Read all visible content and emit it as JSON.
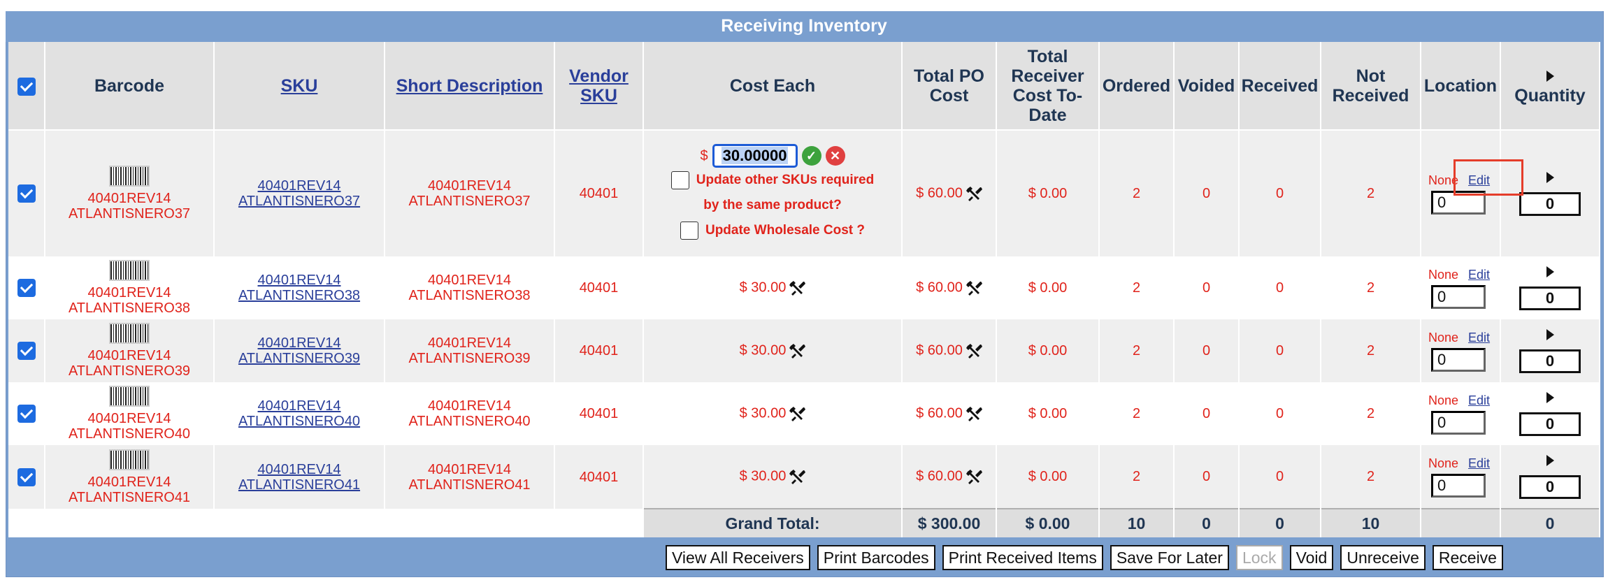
{
  "title": "Receiving Inventory",
  "headers": {
    "barcode": "Barcode",
    "sku": "SKU",
    "short_description": "Short Description",
    "vendor_sku": "Vendor SKU",
    "cost_each": "Cost Each",
    "total_po_cost": "Total PO Cost",
    "total_receiver_cost": "Total Receiver Cost To-Date",
    "ordered": "Ordered",
    "voided": "Voided",
    "received": "Received",
    "not_received": "Not Received",
    "location": "Location",
    "quantity": "Quantity"
  },
  "editing": {
    "currency": "$",
    "value": "30.00000",
    "update_other_skus": "Update other SKUs required",
    "update_other_skus_2": "by the same product?",
    "update_wholesale": "Update Wholesale Cost ?"
  },
  "rows": [
    {
      "barcode_l1": "40401REV14",
      "barcode_l2": "ATLANTISNERO37",
      "sku_l1": "40401REV14",
      "sku_l2": "ATLANTISNERO37",
      "desc_l1": "40401REV14",
      "desc_l2": "ATLANTISNERO37",
      "vendor_sku": "40401",
      "cost_each": "$ 30.00",
      "total_po": "$ 60.00",
      "receiver_cost": "$ 0.00",
      "ordered": "2",
      "voided": "0",
      "received": "0",
      "not_received": "2",
      "loc_none": "None",
      "loc_edit": "Edit",
      "loc_value": "0",
      "qty": "0"
    },
    {
      "barcode_l1": "40401REV14",
      "barcode_l2": "ATLANTISNERO38",
      "sku_l1": "40401REV14",
      "sku_l2": "ATLANTISNERO38",
      "desc_l1": "40401REV14",
      "desc_l2": "ATLANTISNERO38",
      "vendor_sku": "40401",
      "cost_each": "$ 30.00",
      "total_po": "$ 60.00",
      "receiver_cost": "$ 0.00",
      "ordered": "2",
      "voided": "0",
      "received": "0",
      "not_received": "2",
      "loc_none": "None",
      "loc_edit": "Edit",
      "loc_value": "0",
      "qty": "0"
    },
    {
      "barcode_l1": "40401REV14",
      "barcode_l2": "ATLANTISNERO39",
      "sku_l1": "40401REV14",
      "sku_l2": "ATLANTISNERO39",
      "desc_l1": "40401REV14",
      "desc_l2": "ATLANTISNERO39",
      "vendor_sku": "40401",
      "cost_each": "$ 30.00",
      "total_po": "$ 60.00",
      "receiver_cost": "$ 0.00",
      "ordered": "2",
      "voided": "0",
      "received": "0",
      "not_received": "2",
      "loc_none": "None",
      "loc_edit": "Edit",
      "loc_value": "0",
      "qty": "0"
    },
    {
      "barcode_l1": "40401REV14",
      "barcode_l2": "ATLANTISNERO40",
      "sku_l1": "40401REV14",
      "sku_l2": "ATLANTISNERO40",
      "desc_l1": "40401REV14",
      "desc_l2": "ATLANTISNERO40",
      "vendor_sku": "40401",
      "cost_each": "$ 30.00",
      "total_po": "$ 60.00",
      "receiver_cost": "$ 0.00",
      "ordered": "2",
      "voided": "0",
      "received": "0",
      "not_received": "2",
      "loc_none": "None",
      "loc_edit": "Edit",
      "loc_value": "0",
      "qty": "0"
    },
    {
      "barcode_l1": "40401REV14",
      "barcode_l2": "ATLANTISNERO41",
      "sku_l1": "40401REV14",
      "sku_l2": "ATLANTISNERO41",
      "desc_l1": "40401REV14",
      "desc_l2": "ATLANTISNERO41",
      "vendor_sku": "40401",
      "cost_each": "$ 30.00",
      "total_po": "$ 60.00",
      "receiver_cost": "$ 0.00",
      "ordered": "2",
      "voided": "0",
      "received": "0",
      "not_received": "2",
      "loc_none": "None",
      "loc_edit": "Edit",
      "loc_value": "0",
      "qty": "0"
    }
  ],
  "totals": {
    "label": "Grand Total:",
    "total_po": "$ 300.00",
    "receiver_cost": "$ 0.00",
    "ordered": "10",
    "voided": "0",
    "received": "0",
    "not_received": "10",
    "quantity": "0"
  },
  "buttons": {
    "view_all": "View All Receivers",
    "print_barcodes": "Print Barcodes",
    "print_received": "Print Received Items",
    "save_later": "Save For Later",
    "lock": "Lock",
    "void": "Void",
    "unreceive": "Unreceive",
    "receive": "Receive"
  },
  "colors": {
    "header_bar": "#7a9fcf",
    "value_red": "#e0231b",
    "link_blue": "#2a3f9a",
    "checkbox_blue": "#1d6be0",
    "highlight": "#e53d2a"
  },
  "icons": [
    "checkbox-checked-icon",
    "barcode-icon",
    "tools-icon",
    "confirm-icon",
    "cancel-icon",
    "triangle-right-icon"
  ]
}
